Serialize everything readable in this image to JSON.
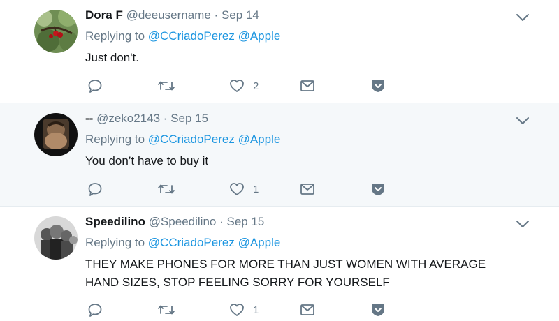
{
  "tweets": [
    {
      "name": "Dora F",
      "handle": "@deeusername",
      "date": "Sep 14",
      "replying_prefix": "Replying to",
      "mentions": [
        "@CCriadoPerez",
        "@Apple"
      ],
      "text": "Just don't.",
      "like_count": "2",
      "avatar_icon": "cherry-tree-photo"
    },
    {
      "name": "--",
      "handle": "@zeko2143",
      "date": "Sep 15",
      "replying_prefix": "Replying to",
      "mentions": [
        "@CCriadoPerez",
        "@Apple"
      ],
      "text": "You don’t have to buy it",
      "like_count": "1",
      "avatar_icon": "person-photo"
    },
    {
      "name": "Speedilino",
      "handle": "@Speedilino",
      "date": "Sep 15",
      "replying_prefix": "Replying to",
      "mentions": [
        "@CCriadoPerez",
        "@Apple"
      ],
      "text_lines": [
        "THEY MAKE PHONES FOR MORE THAN JUST WOMEN WITH AVERAGE",
        "HAND SIZES, STOP FEELING SORRY FOR YOURSELF"
      ],
      "like_count": "1",
      "avatar_icon": "group-photo-bw"
    }
  ],
  "colors": {
    "text": "#14171a",
    "muted": "#657786",
    "link": "#1b95e0",
    "highlight_bg": "#f5f8fa"
  }
}
